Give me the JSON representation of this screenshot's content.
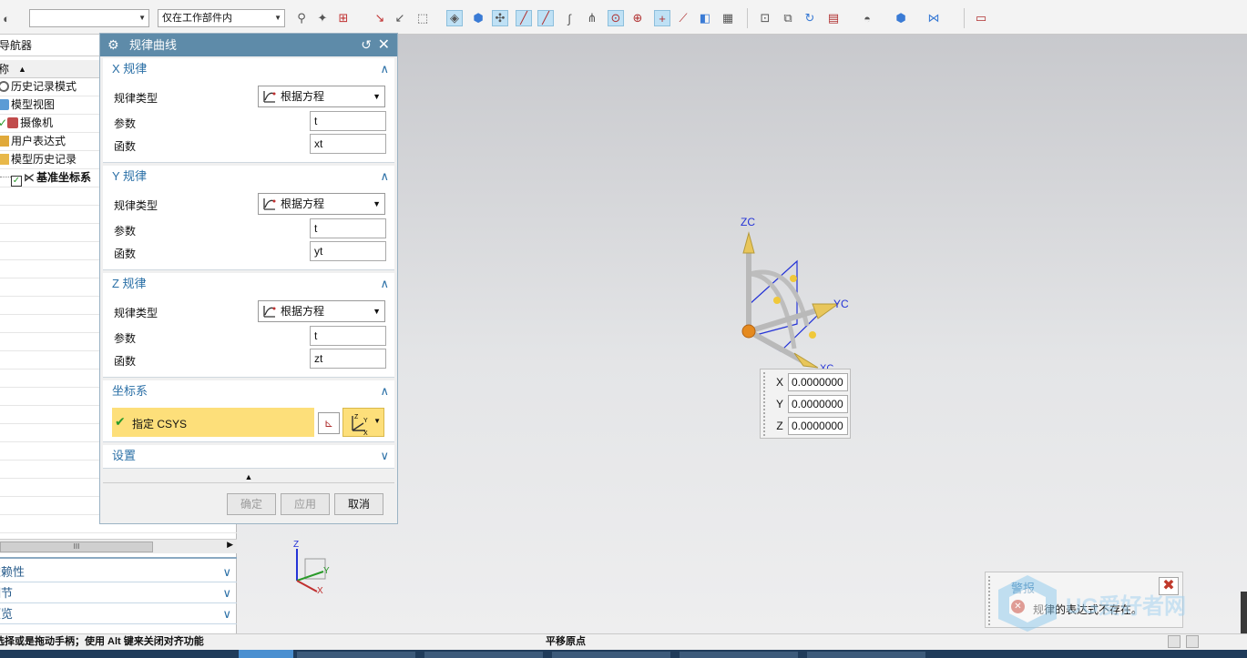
{
  "toolbar": {
    "combo_filter_value": "",
    "combo_scope_value": "仅在工作部件内"
  },
  "navigator": {
    "title": "导航器",
    "column_header": "名称",
    "items": [
      {
        "label": "历史记录模式"
      },
      {
        "label": "模型视图"
      },
      {
        "label": "摄像机"
      },
      {
        "label": "用户表达式"
      },
      {
        "label": "模型历史记录"
      },
      {
        "label": "基准坐标系"
      }
    ],
    "sections": [
      {
        "label": "依赖性"
      },
      {
        "label": "细节"
      },
      {
        "label": "预览"
      }
    ]
  },
  "dialog": {
    "title": "规律曲线",
    "x_group": {
      "title": "X 规律",
      "type_label": "规律类型",
      "type_value": "根据方程",
      "param_label": "参数",
      "param_value": "t",
      "func_label": "函数",
      "func_value": "xt"
    },
    "y_group": {
      "title": "Y 规律",
      "type_label": "规律类型",
      "type_value": "根据方程",
      "param_label": "参数",
      "param_value": "t",
      "func_label": "函数",
      "func_value": "yt"
    },
    "z_group": {
      "title": "Z 规律",
      "type_label": "规律类型",
      "type_value": "根据方程",
      "param_label": "参数",
      "param_value": "t",
      "func_label": "函数",
      "func_value": "zt"
    },
    "csys_group": {
      "title": "坐标系",
      "specify_label": "指定 CSYS"
    },
    "settings_group": {
      "title": "设置"
    },
    "buttons": {
      "ok": "确定",
      "apply": "应用",
      "cancel": "取消"
    }
  },
  "viewport": {
    "axis_z": "ZC",
    "axis_y": "YC",
    "axis_x": "XC",
    "triad_z": "Z",
    "triad_y": "Y",
    "triad_x": "X",
    "coords": [
      {
        "axis": "X",
        "value": "0.0000000"
      },
      {
        "axis": "Y",
        "value": "0.0000000"
      },
      {
        "axis": "Z",
        "value": "0.0000000"
      }
    ]
  },
  "alert": {
    "title": "警报",
    "message": "规律的表达式不存在。"
  },
  "watermark": "UG爱好者网",
  "statusbar": {
    "left": "选择或是拖动手柄；使用 Alt 键来关闭对齐功能",
    "center": "平移原点"
  },
  "colors": {
    "dialog_title": "#5e8ba9",
    "group_header": "#2a6fa6",
    "csys_highlight": "#fddf7a",
    "error": "#c0392b"
  }
}
